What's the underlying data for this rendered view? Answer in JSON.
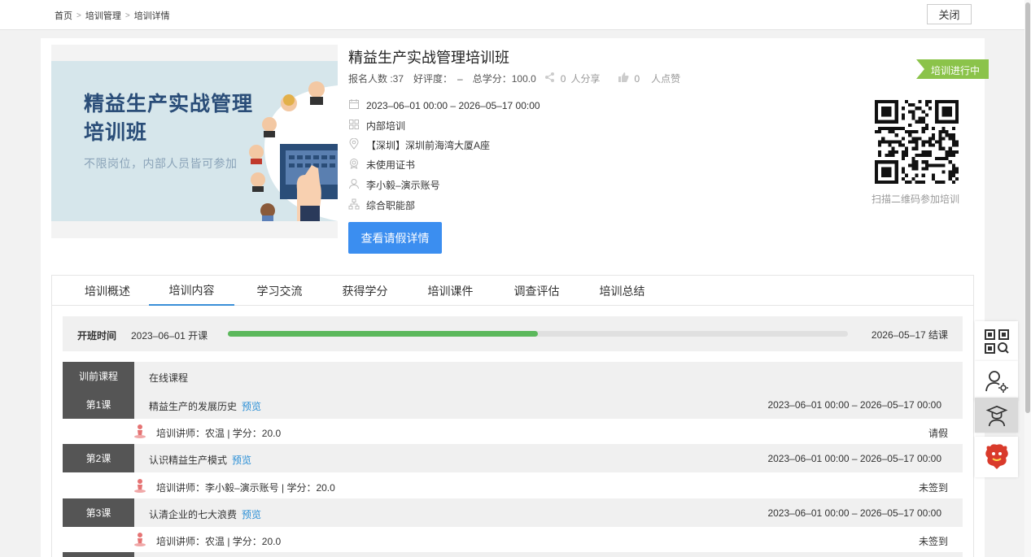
{
  "breadcrumb": {
    "home": "首页",
    "mgmt": "培训管理",
    "detail": "培训详情"
  },
  "close_label": "关闭",
  "banner": {
    "title": "精益生产实战管理培训班",
    "subtitle": "不限岗位，内部人员皆可参加"
  },
  "course": {
    "title": "精益生产实战管理培训班",
    "enroll_label": "报名人数 :37",
    "rating_label": "好评度：",
    "rating_value": "–",
    "credit_label": "总学分：100.0",
    "share_count": "0",
    "share_label": "人分享",
    "like_count": "0",
    "like_label": "人点赞",
    "date_range": "2023–06–01 00:00 – 2026–05–17 00:00",
    "type": "内部培训",
    "location": "【深圳】深圳前海湾大厦A座",
    "certificate": "未使用证书",
    "owner": "李小毅–演示账号",
    "department": "综合职能部",
    "leave_button": "查看请假详情",
    "status": "培训进行中",
    "qr_caption": "扫描二维码参加培训"
  },
  "tabs": [
    "培训概述",
    "培训内容",
    "学习交流",
    "获得学分",
    "培训课件",
    "调查评估",
    "培训总结"
  ],
  "period": {
    "label": "开班时间",
    "start": "2023–06–01 开课",
    "end": "2026–05–17 结课",
    "progress": 0.5
  },
  "pre_course": {
    "badge": "训前课程",
    "name": "在线课程"
  },
  "lessons": [
    {
      "badge": "第1课",
      "name": "精益生产的发展历史",
      "preview": "预览",
      "time": "2023–06–01 00:00 – 2026–05–17 00:00",
      "teacher": "培训讲师：农温 | 学分：20.0",
      "status": "请假"
    },
    {
      "badge": "第2课",
      "name": "认识精益生产模式",
      "preview": "预览",
      "time": "2023–06–01 00:00 – 2026–05–17 00:00",
      "teacher": "培训讲师：李小毅–演示账号 | 学分：20.0",
      "status": "未签到"
    },
    {
      "badge": "第3课",
      "name": "认清企业的七大浪费",
      "preview": "预览",
      "time": "2023–06–01 00:00 – 2026–05–17 00:00",
      "teacher": "培训讲师：农温 | 学分：20.0",
      "status": "未签到"
    }
  ],
  "colors": {
    "accent": "#3b8ef0",
    "progress": "#5cb85c",
    "status": "#8bc34a",
    "badge": "#555555"
  },
  "side_icons": [
    "qr-scan-icon",
    "user-settings-icon",
    "graduate-icon",
    "mascot-icon"
  ]
}
